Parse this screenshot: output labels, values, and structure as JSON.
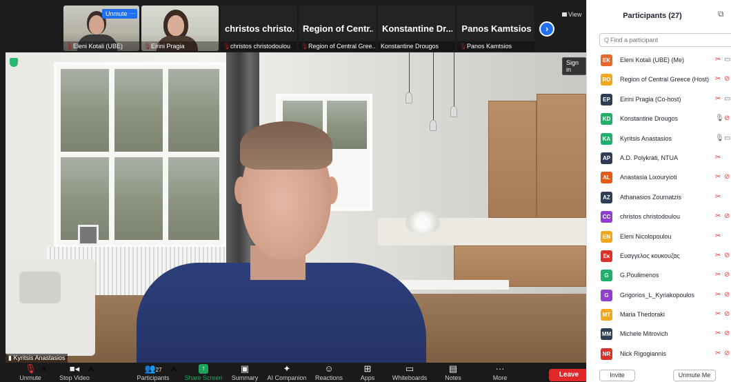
{
  "gallery": {
    "tiles": [
      {
        "name": "Eleni Kotali (UBE)",
        "big": ""
      },
      {
        "name": "Eirini Pragia",
        "big": ""
      },
      {
        "name": "christos christodoulou",
        "big": "christos christo..."
      },
      {
        "name": "Region of Central Gree...",
        "big": "Region of Centr..."
      },
      {
        "name": "Konstantine Drougos",
        "big": "Konstantine Dr..."
      },
      {
        "name": "Panos Kamtsios",
        "big": "Panos Kamtsios"
      }
    ],
    "unmute_label": "Unmute",
    "more_label": "···",
    "next_label": "›",
    "view_label": "View"
  },
  "main_video": {
    "speaker": "Kyritsis Anastasios",
    "sign_in_label": "Sign in"
  },
  "toolbar": {
    "unmute": "Unmute",
    "stop_video": "Stop Video",
    "participants": "Participants",
    "participants_count": "27",
    "share_screen": "Share Screen",
    "summary": "Summary",
    "ai_companion": "AI Companion",
    "reactions": "Reactions",
    "apps": "Apps",
    "whiteboards": "Whiteboards",
    "notes": "Notes",
    "more": "More",
    "leave": "Leave"
  },
  "panel": {
    "title": "Participants (27)",
    "search_placeholder": "Find a participant",
    "invite": "Invite",
    "unmute_me": "Unmute Me",
    "participants": [
      {
        "initials": "EK",
        "name": "Eleni Kotali (UBE) (Me)",
        "color": "#e8682a",
        "mic": "off",
        "video": "on"
      },
      {
        "initials": "RO",
        "name": "Region of Central Greece (Host)",
        "color": "#f2a81d",
        "mic": "off",
        "video": "off"
      },
      {
        "initials": "EP",
        "name": "Eirini Pragia (Co-host)",
        "color": "#2e3e56",
        "mic": "off",
        "video": "on"
      },
      {
        "initials": "KD",
        "name": "Konstantine Drougos",
        "color": "#1fb06b",
        "mic": "on",
        "video": "off"
      },
      {
        "initials": "KA",
        "name": "Kyritsis Anastasios",
        "color": "#1fb06b",
        "mic": "on",
        "video": "on"
      },
      {
        "initials": "AP",
        "name": "A.D. Polykrati, NTUA",
        "color": "#2e3e56",
        "mic": "off",
        "video": ""
      },
      {
        "initials": "AL",
        "name": "Anastasia Lixouryioti",
        "color": "#e35b19",
        "mic": "off",
        "video": "off"
      },
      {
        "initials": "AZ",
        "name": "Athanasios Zournatzis",
        "color": "#2e3e56",
        "mic": "off",
        "video": ""
      },
      {
        "initials": "CC",
        "name": "christos christodoulou",
        "color": "#8e3fcf",
        "mic": "off",
        "video": "off"
      },
      {
        "initials": "EN",
        "name": "Eleni Nicolopoulou",
        "color": "#f2a81d",
        "mic": "off",
        "video": ""
      },
      {
        "initials": "Εκ",
        "name": "Ευαγγελος κουκουζας",
        "color": "#d8322a",
        "mic": "off",
        "video": "off"
      },
      {
        "initials": "G",
        "name": "G.Poulimenos",
        "color": "#1fb06b",
        "mic": "off",
        "video": "off"
      },
      {
        "initials": "G",
        "name": "Grigorios_L_Kyriakopoulos",
        "color": "#8e3fcf",
        "mic": "off",
        "video": "off"
      },
      {
        "initials": "MT",
        "name": "Maria Thedoraki",
        "color": "#f2a81d",
        "mic": "off",
        "video": "off"
      },
      {
        "initials": "MM",
        "name": "Michele Mitrovich",
        "color": "#2e3e56",
        "mic": "off",
        "video": "off"
      },
      {
        "initials": "NR",
        "name": "Nick Rigogiannis",
        "color": "#d8322a",
        "mic": "off",
        "video": "off"
      }
    ]
  }
}
